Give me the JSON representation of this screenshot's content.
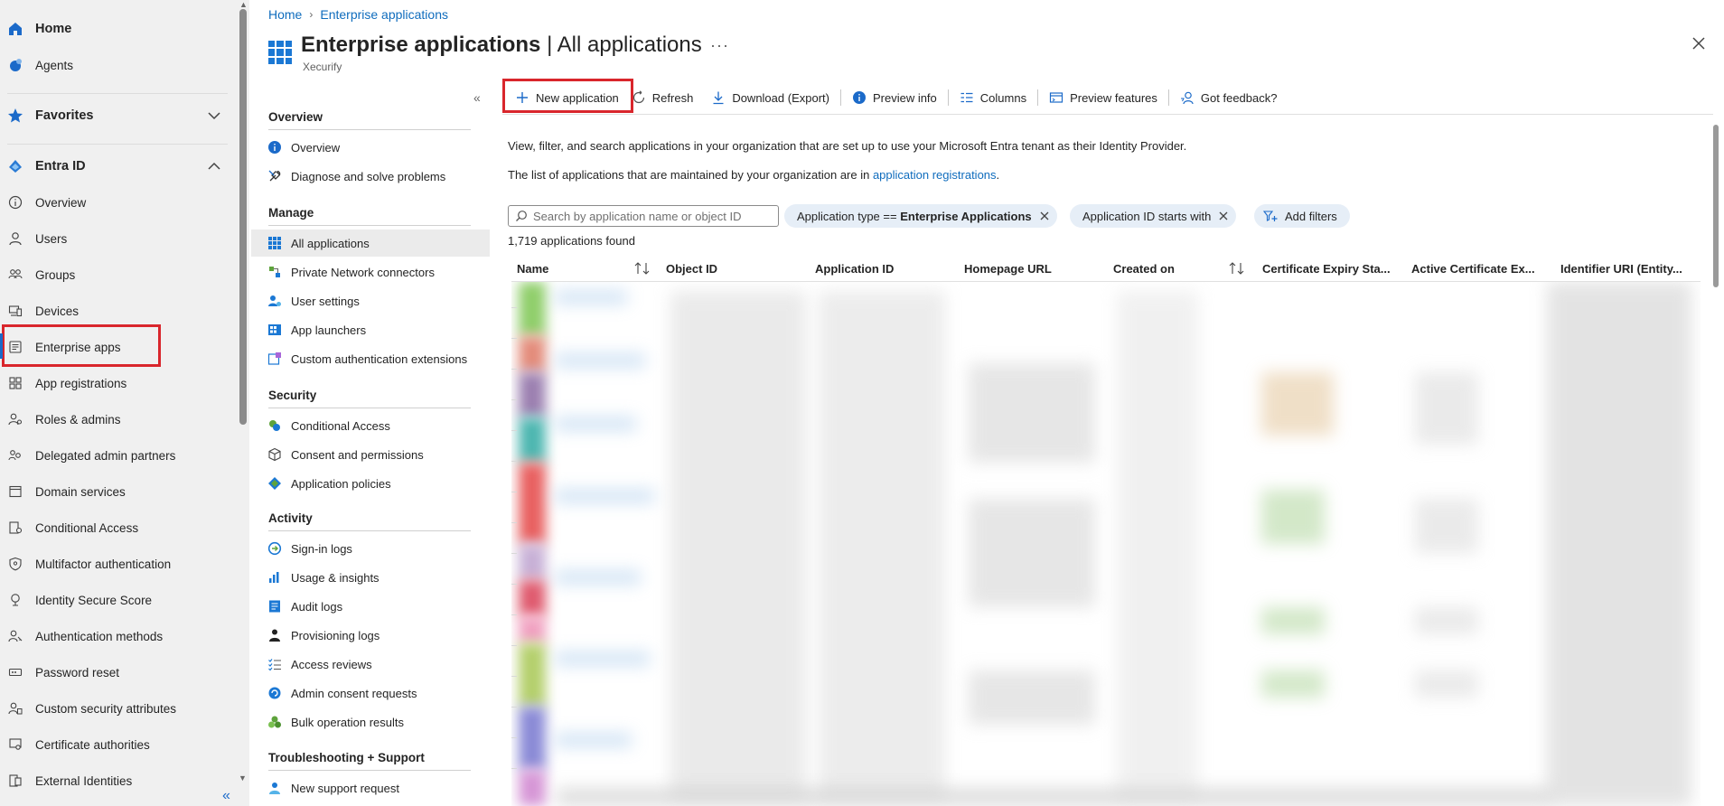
{
  "leftnav": {
    "home": "Home",
    "agents": "Agents",
    "favorites": "Favorites",
    "entra": "Entra ID",
    "items": [
      "Overview",
      "Users",
      "Groups",
      "Devices",
      "Enterprise apps",
      "App registrations",
      "Roles & admins",
      "Delegated admin partners",
      "Domain services",
      "Conditional Access",
      "Multifactor authentication",
      "Identity Secure Score",
      "Authentication methods",
      "Password reset",
      "Custom security attributes",
      "Certificate authorities",
      "External Identities"
    ]
  },
  "header": {
    "breadcrumb_home": "Home",
    "breadcrumb_current": "Enterprise applications",
    "title_main": "Enterprise applications",
    "title_rest": " | All applications",
    "subtitle": "Xecurify",
    "more": "···"
  },
  "blade": {
    "sections": {
      "overview": "Overview",
      "manage": "Manage",
      "security": "Security",
      "activity": "Activity",
      "troubleshooting": "Troubleshooting + Support"
    },
    "overview_items": [
      "Overview",
      "Diagnose and solve problems"
    ],
    "manage_items": [
      "All applications",
      "Private Network connectors",
      "User settings",
      "App launchers",
      "Custom authentication extensions"
    ],
    "security_items": [
      "Conditional Access",
      "Consent and permissions",
      "Application policies"
    ],
    "activity_items": [
      "Sign-in logs",
      "Usage & insights",
      "Audit logs",
      "Provisioning logs",
      "Access reviews",
      "Admin consent requests",
      "Bulk operation results"
    ],
    "support_items": [
      "New support request"
    ]
  },
  "toolbar": {
    "new_application": "New application",
    "refresh": "Refresh",
    "download": "Download (Export)",
    "preview_info": "Preview info",
    "columns": "Columns",
    "preview_features": "Preview features",
    "feedback": "Got feedback?"
  },
  "content": {
    "desc1": "View, filter, and search applications in your organization that are set up to use your Microsoft Entra tenant as their Identity Provider.",
    "desc2_pre": "The list of applications that are maintained by your organization are in ",
    "desc2_link": "application registrations",
    "desc2_post": ".",
    "search_placeholder": "Search by application name or object ID",
    "filter1_label": "Application type == ",
    "filter1_value": "Enterprise Applications",
    "filter2_label": "Application ID starts with",
    "add_filters": "Add filters",
    "count": "1,719 applications found"
  },
  "table": {
    "columns": [
      "Name",
      "Object ID",
      "Application ID",
      "Homepage URL",
      "Created on",
      "Certificate Expiry Sta...",
      "Active Certificate Ex...",
      "Identifier URI (Entity..."
    ]
  },
  "colors": {
    "accent": "#0f6cbd",
    "highlight": "#d9262c",
    "nav_bg": "#f0f0f0"
  }
}
